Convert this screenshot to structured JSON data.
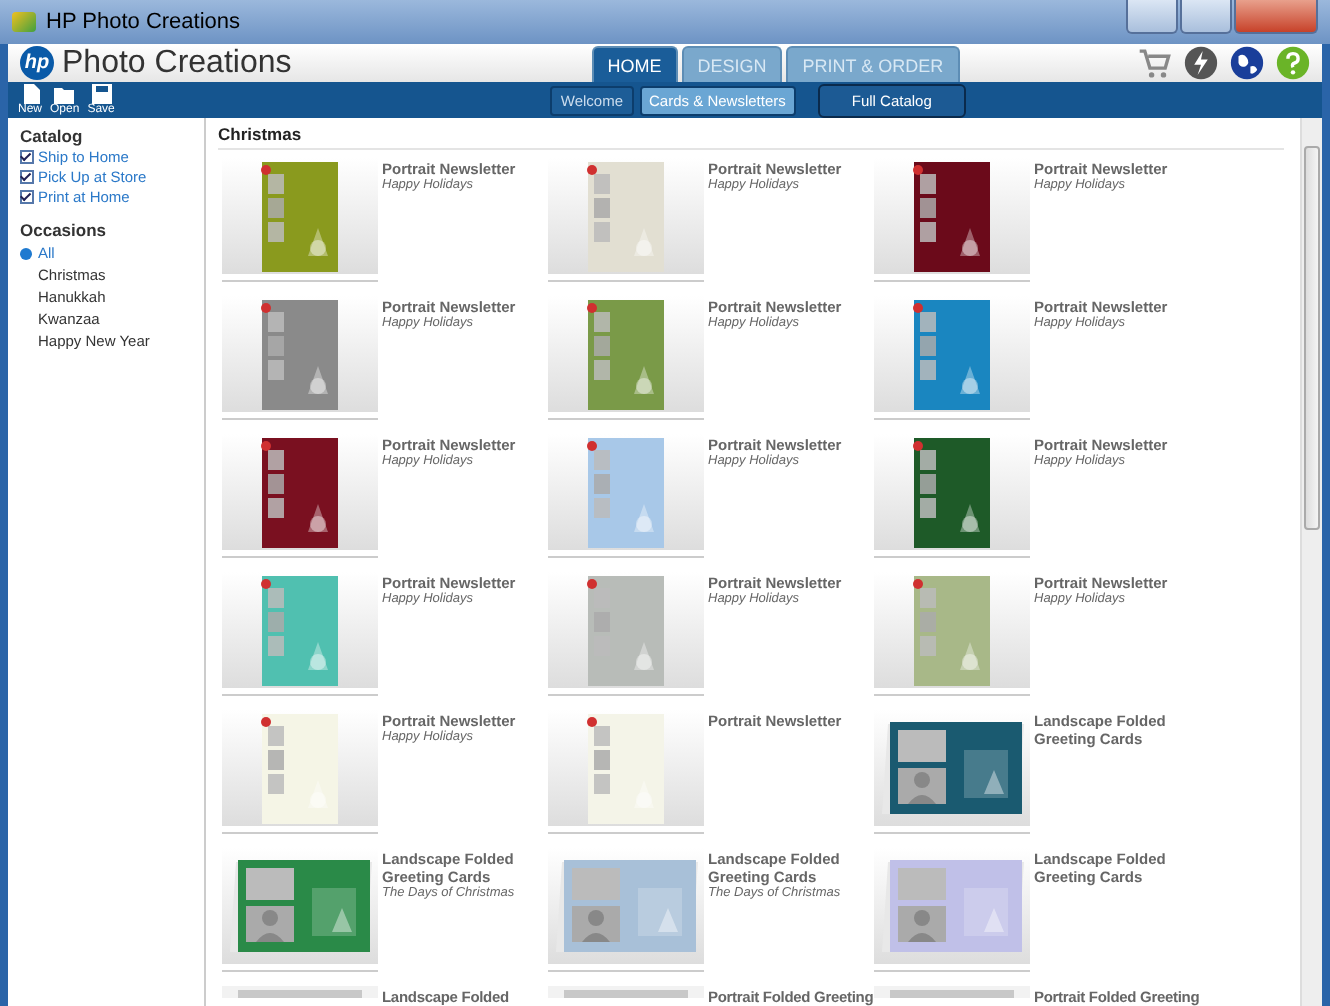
{
  "window": {
    "title": "HP Photo Creations"
  },
  "header": {
    "logo": "hp",
    "app_name": "Photo Creations"
  },
  "tabs": [
    {
      "label": "HOME",
      "selected": true
    },
    {
      "label": "DESIGN",
      "selected": false
    },
    {
      "label": "PRINT & ORDER",
      "selected": false
    }
  ],
  "toolbar": [
    {
      "label": "New",
      "kind": "new"
    },
    {
      "label": "Open",
      "kind": "open"
    },
    {
      "label": "Save",
      "kind": "save"
    }
  ],
  "subnav": [
    {
      "label": "Welcome",
      "selected": false
    },
    {
      "label": "Cards & Newsletters",
      "selected": true
    }
  ],
  "catalog_button": "Full Catalog",
  "sidebar": {
    "catalog_title": "Catalog",
    "catalog": [
      {
        "label": "Ship to Home",
        "checked": true
      },
      {
        "label": "Pick Up at Store",
        "checked": true
      },
      {
        "label": "Print at Home",
        "checked": true
      }
    ],
    "occasions_title": "Occasions",
    "occasions": [
      {
        "label": "All",
        "selected": true
      },
      {
        "label": "Christmas",
        "selected": false
      },
      {
        "label": "Hanukkah",
        "selected": false
      },
      {
        "label": "Kwanzaa",
        "selected": false
      },
      {
        "label": "Happy New Year",
        "selected": false
      }
    ]
  },
  "section_title": "Christmas",
  "products": [
    {
      "title": "Portrait Newsletter",
      "subtitle": "Happy Holidays",
      "kind": "portrait"
    },
    {
      "title": "Portrait Newsletter",
      "subtitle": "Happy Holidays",
      "kind": "portrait"
    },
    {
      "title": "Portrait Newsletter",
      "subtitle": "Happy Holidays",
      "kind": "portrait"
    },
    {
      "title": "Portrait Newsletter",
      "subtitle": "Happy Holidays",
      "kind": "portrait"
    },
    {
      "title": "Portrait Newsletter",
      "subtitle": "Happy Holidays",
      "kind": "portrait"
    },
    {
      "title": "Portrait Newsletter",
      "subtitle": "Happy Holidays",
      "kind": "portrait"
    },
    {
      "title": "Portrait Newsletter",
      "subtitle": "Happy Holidays",
      "kind": "portrait"
    },
    {
      "title": "Portrait Newsletter",
      "subtitle": "Happy Holidays",
      "kind": "portrait"
    },
    {
      "title": "Portrait Newsletter",
      "subtitle": "Happy Holidays",
      "kind": "portrait"
    },
    {
      "title": "Portrait Newsletter",
      "subtitle": "Happy Holidays",
      "kind": "portrait"
    },
    {
      "title": "Portrait Newsletter",
      "subtitle": "Happy Holidays",
      "kind": "portrait"
    },
    {
      "title": "Portrait Newsletter",
      "subtitle": "Happy Holidays",
      "kind": "portrait"
    },
    {
      "title": "Portrait Newsletter",
      "subtitle": "Happy Holidays",
      "kind": "portrait"
    },
    {
      "title": "Portrait Newsletter",
      "kind": "portrait"
    },
    {
      "title": "Landscape Folded Greeting Cards",
      "kind": "landscape"
    },
    {
      "title": "Landscape Folded Greeting Cards",
      "subtitle": "The Days of Christmas",
      "kind": "landscape"
    },
    {
      "title": "Landscape Folded Greeting Cards",
      "subtitle": "The Days of Christmas",
      "kind": "landscape"
    },
    {
      "title": "Landscape Folded Greeting Cards",
      "kind": "landscape"
    },
    {
      "title": "Landscape Folded",
      "kind": "partial"
    },
    {
      "title": "Portrait Folded Greeting",
      "kind": "partial"
    },
    {
      "title": "Portrait Folded Greeting",
      "kind": "partial"
    }
  ]
}
